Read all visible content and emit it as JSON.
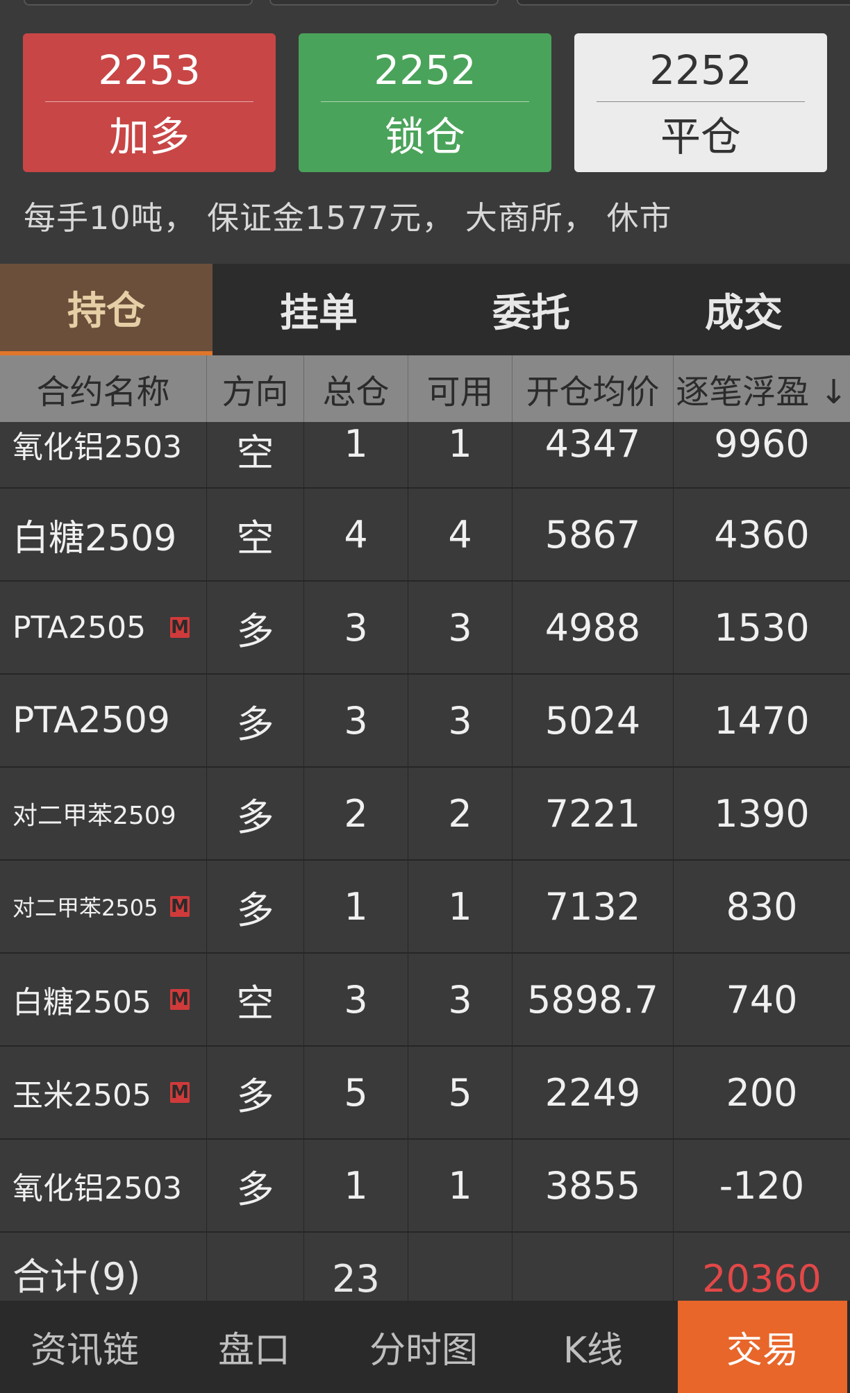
{
  "actions": [
    {
      "price": "2253",
      "label": "加多",
      "style": "red",
      "color": "#c84646"
    },
    {
      "price": "2252",
      "label": "锁仓",
      "style": "green",
      "color": "#4aa35a"
    },
    {
      "price": "2252",
      "label": "平仓",
      "style": "white",
      "color": "#ececec"
    }
  ],
  "info": "每手10吨， 保证金1577元， 大商所， 休市",
  "tabs": [
    "持仓",
    "挂单",
    "委托",
    "成交"
  ],
  "active_tab": "持仓",
  "columns": [
    "合约名称",
    "方向",
    "总仓",
    "可用",
    "开仓均价",
    "逐笔浮盈 ↓"
  ],
  "rows": [
    {
      "name": "氧化铝2503",
      "m": false,
      "dir": "空",
      "total": "1",
      "avail": "1",
      "avg": "4347",
      "pnl": "9960"
    },
    {
      "name": "白糖2509",
      "m": false,
      "dir": "空",
      "total": "4",
      "avail": "4",
      "avg": "5867",
      "pnl": "4360"
    },
    {
      "name": "PTA2505",
      "m": true,
      "dir": "多",
      "total": "3",
      "avail": "3",
      "avg": "4988",
      "pnl": "1530"
    },
    {
      "name": "PTA2509",
      "m": false,
      "dir": "多",
      "total": "3",
      "avail": "3",
      "avg": "5024",
      "pnl": "1470"
    },
    {
      "name": "对二甲苯2509",
      "m": false,
      "dir": "多",
      "total": "2",
      "avail": "2",
      "avg": "7221",
      "pnl": "1390"
    },
    {
      "name": "对二甲苯2505",
      "m": true,
      "dir": "多",
      "total": "1",
      "avail": "1",
      "avg": "7132",
      "pnl": "830"
    },
    {
      "name": "白糖2505",
      "m": true,
      "dir": "空",
      "total": "3",
      "avail": "3",
      "avg": "5898.7",
      "pnl": "740"
    },
    {
      "name": "玉米2505",
      "m": true,
      "dir": "多",
      "total": "5",
      "avail": "5",
      "avg": "2249",
      "pnl": "200"
    },
    {
      "name": "氧化铝2503",
      "m": false,
      "dir": "多",
      "total": "1",
      "avail": "1",
      "avg": "3855",
      "pnl": "-120"
    }
  ],
  "badge_label": "M",
  "total_row": {
    "label": "合计(9)",
    "total": "23",
    "pnl": "20360"
  },
  "bottom_nav": [
    "资讯链",
    "盘口",
    "分时图",
    "K线",
    "交易"
  ],
  "active_nav": "交易",
  "colors": {
    "long": "#e24848",
    "short": "#3fc14a",
    "profit": "#e24848",
    "loss": "#3fc14a",
    "accent": "#e8662a"
  }
}
